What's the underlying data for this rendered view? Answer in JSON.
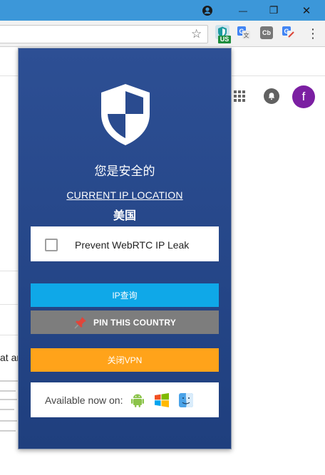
{
  "browser": {
    "titlebar_color": "#3c97d9",
    "window_controls": [
      "account-icon",
      "minimize-icon",
      "restore-icon",
      "close-icon"
    ],
    "minimize_glyph": "—",
    "restore_glyph": "❐",
    "close_glyph": "✕",
    "star_glyph": "☆",
    "menu_glyph": "⋮",
    "extensions": [
      {
        "name": "vpn-extension-icon",
        "badge": "US",
        "active": true
      },
      {
        "name": "google-translate-icon"
      },
      {
        "name": "cb-extension-icon",
        "label": "Cb"
      },
      {
        "name": "google-translate-alt-icon"
      }
    ]
  },
  "page": {
    "avatar_letter": "f",
    "fragment_text": "at ar"
  },
  "popup": {
    "status_text": "您是安全的",
    "current_ip_location_label": "CURRENT IP LOCATION",
    "country": "美国",
    "webrtc_label": "Prevent WebRTC IP Leak",
    "ip_query_button": "IP查询",
    "pin_country_button": "PIN THIS COUNTRY",
    "disconnect_button": "关闭VPN",
    "available_label": "Available now on:",
    "platforms": [
      "android-icon",
      "windows-icon",
      "mac-finder-icon"
    ],
    "colors": {
      "background": "#2a4b8f",
      "ip_button": "#0fa8e8",
      "pin_button": "#7d7d7d",
      "vpn_button": "#ffa31a"
    }
  }
}
